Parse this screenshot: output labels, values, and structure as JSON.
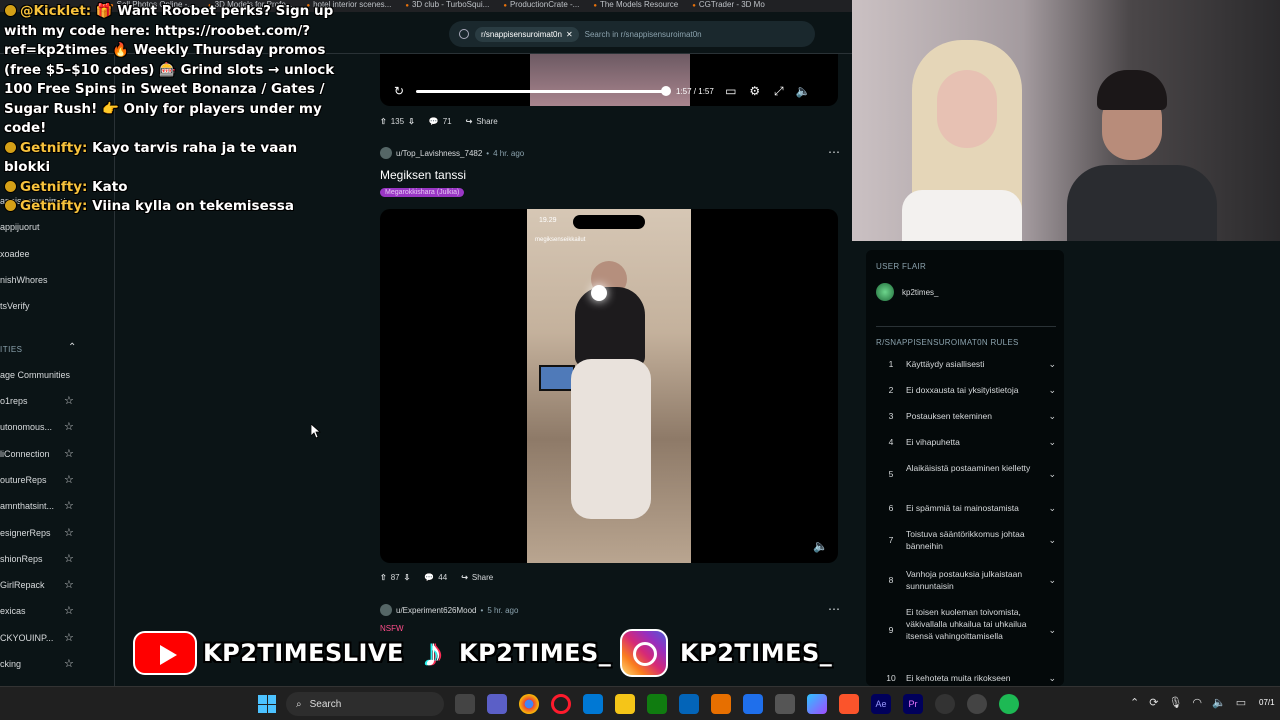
{
  "bookmarks": [
    "Sell Photos Online -...",
    "3D Models for Profe...",
    "hotel interior scenes...",
    "3D club - TurboSqui...",
    "ProductionCrate -...",
    "The Models Resource",
    "CGTrader - 3D Mo"
  ],
  "header": {
    "subreddit_chip": "r/snappisensuroimat0n",
    "search_placeholder": "Search in r/snappisensuroimat0n"
  },
  "sidebar": {
    "items_top": [
      "appisensuroimat...",
      "appijuorut",
      "xoadee",
      "nishWhores",
      "tsVerify"
    ],
    "section_label": "ITIES",
    "manage": "age Communities",
    "communities": [
      "o1reps",
      "utonomous...",
      "liConnection",
      "outureReps",
      "amnthatsint...",
      "esignerReps",
      "shionReps",
      "GirlRepack",
      "exicas",
      "CKYOUINP...",
      "cking"
    ]
  },
  "top_post": {
    "time": "1:57 / 1:57",
    "votes": "135",
    "comments": "71",
    "share": "Share"
  },
  "post2": {
    "user": "u/Top_Lavishness_7482",
    "age": "4 hr. ago",
    "title": "Megiksen tanssi",
    "flair": "Megarokkishara (Julkia)",
    "phone_clock": "19.29",
    "phone_caption": "megiksenseikkailut",
    "votes": "87",
    "comments": "44",
    "share": "Share"
  },
  "post3": {
    "user": "u/Experiment626Mood",
    "age": "5 hr. ago",
    "nsfw": "NSFW"
  },
  "right_panel": {
    "user_flair_label": "USER FLAIR",
    "flair_user": "kp2times_",
    "rules_label": "R/SNAPPISENSUROIMAT0N RULES",
    "rules": [
      {
        "n": "1",
        "t": "Käyttäydy asiallisesti"
      },
      {
        "n": "2",
        "t": "Ei doxxausta tai yksityistietoja"
      },
      {
        "n": "3",
        "t": "Postauksen tekeminen"
      },
      {
        "n": "4",
        "t": "Ei vihapuhetta"
      },
      {
        "n": "5",
        "t": "Alaikäisistä postaaminen kielletty"
      },
      {
        "n": "6",
        "t": "Ei spämmiä tai mainostamista"
      },
      {
        "n": "7",
        "t": "Toistuva sääntörikkomus johtaa bänneihin"
      },
      {
        "n": "8",
        "t": "Vanhoja postauksia julkaistaan sunnuntaisin"
      },
      {
        "n": "9",
        "t": "Ei toisen kuoleman toivomista, väkivallalla uhkailua tai uhkailua itsensä vahingoittamisella"
      },
      {
        "n": "10",
        "t": "Ei kehoteta muita rikokseen"
      }
    ]
  },
  "chat": [
    {
      "user": "@Kicklet:",
      "msg": "🎁 Want Roobet perks? Sign up with my code here: https://roobet.com/?ref=kp2times 🔥 Weekly Thursday promos (free $5–$10 codes) 🎰 Grind slots → unlock 100 Free Spins in Sweet Bonanza / Gates / Sugar Rush! 👉 Only for players under my code!"
    },
    {
      "user": "Getnifty:",
      "msg": "Kayo tarvis raha ja te vaan blokki"
    },
    {
      "user": "Getnifty:",
      "msg": "Kato"
    },
    {
      "user": "Getnifty:",
      "msg": "Viina kylla on tekemisessa"
    }
  ],
  "social": {
    "youtube": "KP2TIMESLIVE",
    "tiktok": "KP2TIMES_",
    "instagram": "KP2TIMES_"
  },
  "taskbar": {
    "search": "Search",
    "clock": "07/1"
  }
}
